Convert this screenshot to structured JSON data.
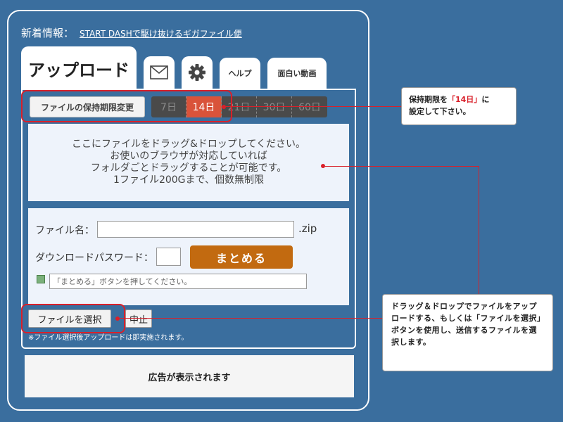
{
  "news": {
    "label": "新着情報：",
    "link": "START DASHで駆け抜けるギガファイル便"
  },
  "tabs": {
    "upload": "アップロード",
    "mail_icon": "mail-icon",
    "gear_icon": "gear-icon",
    "help": "ヘルプ",
    "video": "面白い動画"
  },
  "retention": {
    "button": "ファイルの保持期限変更",
    "days": [
      "7日",
      "14日",
      "21日",
      "30日",
      "60日"
    ],
    "selected": "14日"
  },
  "drop_area": {
    "lines": [
      "ここにファイルをドラッグ&ドロップしてください。",
      "お使いのブラウザが対応していれば",
      "フォルダごとドラッグすることが可能です。",
      "1ファイル200Gまで、個数無制限"
    ]
  },
  "form": {
    "filename_label": "ファイル名：",
    "filename_value": "",
    "ext": ".zip",
    "password_label": "ダウンロードパスワード：",
    "password_value": "",
    "matomeru": "まとめる",
    "status_icon": "plus-file-icon",
    "status_text": "「まとめる」ボタンを押してください。"
  },
  "actions": {
    "select_file": "ファイルを選択",
    "cancel": "中止",
    "note": "※ファイル選択後アップロードは即実施されます。"
  },
  "ad": {
    "text": "広告が表示されます"
  },
  "callouts": {
    "retention_line1_prefix": "保持期限を",
    "retention_highlight": "「14日」",
    "retention_line1_suffix": "に",
    "retention_line2": "設定して下さい。",
    "drag_text": "ドラッグ＆ドロップでファイルをアップロードする、もしくは「ファイルを選択」ボタンを使用し、送信するファイルを選択します。"
  },
  "colors": {
    "background": "#3a6e9e",
    "accent_red": "#d9202a",
    "active_day": "#d9533a",
    "matomeru_button": "#c26a10"
  }
}
